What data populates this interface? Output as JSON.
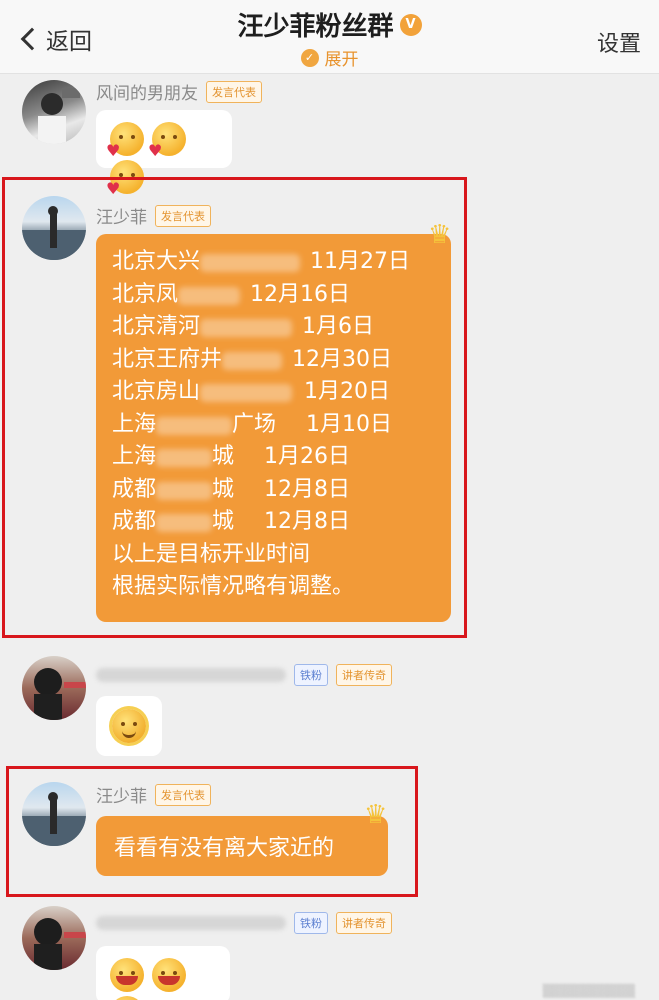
{
  "header": {
    "back_label": "返回",
    "title": "汪少菲粉丝群",
    "verified_badge": "V",
    "expand_label": "展开",
    "settings_label": "设置"
  },
  "messages": [
    {
      "sender": "风间的男朋友",
      "tag": "发言代表"
    },
    {
      "sender": "汪少菲",
      "tag": "发言代表",
      "rows": [
        {
          "city": "北京大兴",
          "date": "11月27日"
        },
        {
          "city": "北京凤",
          "date": "12月16日"
        },
        {
          "city": "北京清河",
          "date": "1月6日"
        },
        {
          "city": "北京王府井",
          "date": "12月30日"
        },
        {
          "city": "北京房山",
          "date": "1月20日"
        },
        {
          "city": "上海",
          "mid": "广场",
          "date": "1月10日"
        },
        {
          "city": "上海",
          "mid": "城",
          "date": "1月26日"
        },
        {
          "city": "成都",
          "mid": "城",
          "date": "12月8日"
        },
        {
          "city": "成都",
          "mid": "城",
          "date": "12月8日"
        }
      ],
      "footer_line1": "以上是目标开业时间",
      "footer_line2": "根据实际情况略有调整。"
    },
    {
      "tag1": "铁粉",
      "tag2": "讲者传奇"
    },
    {
      "sender": "汪少菲",
      "tag": "发言代表",
      "text": "看看有没有离大家近的"
    },
    {
      "tag1": "铁粉",
      "tag2": "讲者传奇"
    }
  ],
  "colors": {
    "bubble_orange": "#f29a38",
    "highlight_red": "#d8161c",
    "accent": "#e8932d"
  }
}
